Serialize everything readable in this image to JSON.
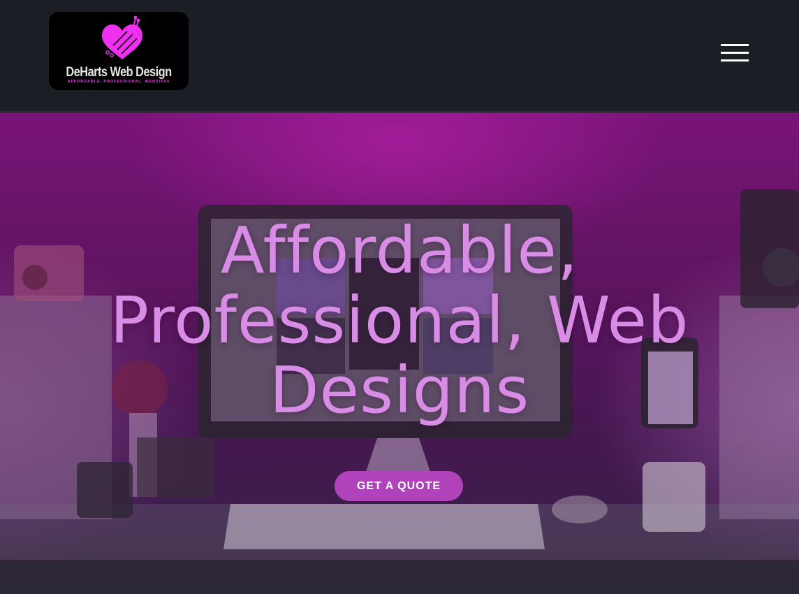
{
  "header": {
    "logo": {
      "name": "DeHarts Web Design",
      "tagline": "AFFORDABLE, PROFESSIONAL, WEBSITES"
    },
    "menu_icon": "hamburger-menu-icon"
  },
  "hero": {
    "title": "Affordable, Professional, Web Designs",
    "cta_label": "GET A QUOTE"
  },
  "colors": {
    "header_bg": "#1b1e24",
    "title": "#d98ce6",
    "cta_bg": "#b043b9",
    "logo_accent": "#e13fe4"
  }
}
